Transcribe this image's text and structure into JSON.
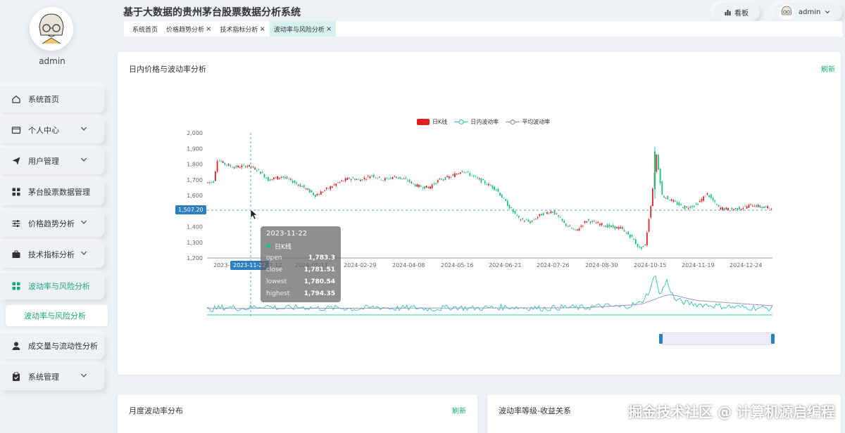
{
  "app": {
    "title": "基于大数据的贵州茅台股票数据分析系统"
  },
  "sidebar": {
    "username": "admin",
    "items": [
      {
        "label": "系统首页",
        "icon": "home-icon"
      },
      {
        "label": "个人中心",
        "icon": "id-card-icon"
      },
      {
        "label": "用户管理",
        "icon": "send-icon"
      },
      {
        "label": "茅台股票数据管理",
        "icon": "grid-icon"
      },
      {
        "label": "价格趋势分析",
        "icon": "sliders-icon"
      },
      {
        "label": "技术指标分析",
        "icon": "briefcase-icon"
      },
      {
        "label": "波动率与风险分析",
        "icon": "grid-icon"
      },
      {
        "label": "成交量与流动性分析",
        "icon": "user-icon"
      },
      {
        "label": "系统管理",
        "icon": "clipboard-icon"
      }
    ],
    "active_sub": "波动率与风险分析"
  },
  "tabs": [
    {
      "label": "系统首页",
      "closable": false
    },
    {
      "label": "价格趋势分析",
      "closable": true
    },
    {
      "label": "技术指标分析",
      "closable": true
    },
    {
      "label": "波动率与风险分析",
      "closable": true
    }
  ],
  "header": {
    "kanban": "看板",
    "user": "admin"
  },
  "main": {
    "card1_title": "日内价格与波动率分析",
    "refresh": "刷新",
    "card2_title": "月度波动率分布",
    "card3_title": "波动率等级-收益关系"
  },
  "tooltip": {
    "date": "2023-11-22",
    "series": "日K线",
    "rows": [
      {
        "k": "open",
        "v": "1,783.3"
      },
      {
        "k": "close",
        "v": "1,781.51"
      },
      {
        "k": "lowest",
        "v": "1,780.54"
      },
      {
        "k": "highest",
        "v": "1,794.35"
      }
    ]
  },
  "axis_pointer": {
    "y_label": "1,507.20",
    "x_label": "2023-11-22"
  },
  "colors": {
    "accent": "#19a974",
    "up": "#e02020",
    "down": "#19c37d",
    "vol_line": "#3fc8b8",
    "avg_line": "#a58fc8",
    "axis_tag": "#2c7fc0"
  },
  "watermark": "掘金技术社区 @ 计算机源启编程",
  "chart_data": {
    "type": "candlestick",
    "legend": [
      "日K线",
      "日内波动率",
      "平均波动率"
    ],
    "ylim": [
      1200,
      2000
    ],
    "y_ticks": [
      "2,000",
      "1,900",
      "1,800",
      "1,700",
      "1,600",
      "1,500",
      "1,400",
      "1,300",
      "1,200"
    ],
    "x_ticks": [
      "2023-",
      "2023-12-12",
      "2024-01-17",
      "2024-02-29",
      "2024-04-08",
      "2024-05-16",
      "2024-06-21",
      "2024-07-26",
      "2024-08-30",
      "2024-10-15",
      "2024-11-19",
      "2024-12-24"
    ],
    "price_path": [
      [
        0,
        1680
      ],
      [
        4,
        1690
      ],
      [
        6,
        1830
      ],
      [
        10,
        1800
      ],
      [
        15,
        1780
      ],
      [
        22,
        1790
      ],
      [
        28,
        1760
      ],
      [
        33,
        1700
      ],
      [
        40,
        1720
      ],
      [
        46,
        1690
      ],
      [
        52,
        1650
      ],
      [
        58,
        1600
      ],
      [
        64,
        1640
      ],
      [
        70,
        1680
      ],
      [
        76,
        1710
      ],
      [
        82,
        1700
      ],
      [
        88,
        1730
      ],
      [
        94,
        1700
      ],
      [
        100,
        1720
      ],
      [
        106,
        1700
      ],
      [
        112,
        1660
      ],
      [
        118,
        1650
      ],
      [
        124,
        1700
      ],
      [
        130,
        1720
      ],
      [
        136,
        1760
      ],
      [
        142,
        1720
      ],
      [
        148,
        1680
      ],
      [
        154,
        1640
      ],
      [
        160,
        1540
      ],
      [
        166,
        1450
      ],
      [
        172,
        1430
      ],
      [
        178,
        1480
      ],
      [
        184,
        1500
      ],
      [
        190,
        1420
      ],
      [
        196,
        1370
      ],
      [
        202,
        1440
      ],
      [
        208,
        1420
      ],
      [
        214,
        1400
      ],
      [
        220,
        1390
      ],
      [
        226,
        1330
      ],
      [
        230,
        1260
      ],
      [
        233,
        1280
      ],
      [
        236,
        1540
      ],
      [
        239,
        1860
      ],
      [
        242,
        1600
      ],
      [
        248,
        1560
      ],
      [
        254,
        1520
      ],
      [
        260,
        1540
      ],
      [
        266,
        1610
      ],
      [
        272,
        1520
      ],
      [
        278,
        1510
      ],
      [
        284,
        1520
      ],
      [
        290,
        1540
      ],
      [
        296,
        1520
      ],
      [
        300,
        1525
      ]
    ],
    "volatility_path": [
      [
        0,
        0.4
      ],
      [
        10,
        0.6
      ],
      [
        20,
        0.5
      ],
      [
        30,
        0.7
      ],
      [
        40,
        0.5
      ],
      [
        50,
        0.6
      ],
      [
        60,
        0.5
      ],
      [
        70,
        0.55
      ],
      [
        80,
        0.45
      ],
      [
        90,
        0.6
      ],
      [
        100,
        0.5
      ],
      [
        110,
        0.55
      ],
      [
        120,
        0.45
      ],
      [
        130,
        0.6
      ],
      [
        140,
        0.5
      ],
      [
        150,
        0.55
      ],
      [
        160,
        0.6
      ],
      [
        170,
        0.55
      ],
      [
        180,
        0.5
      ],
      [
        190,
        0.6
      ],
      [
        200,
        0.55
      ],
      [
        210,
        0.7
      ],
      [
        220,
        0.6
      ],
      [
        230,
        0.9
      ],
      [
        235,
        1.9
      ],
      [
        238,
        3.2
      ],
      [
        240,
        1.5
      ],
      [
        244,
        2.6
      ],
      [
        248,
        1.2
      ],
      [
        255,
        0.9
      ],
      [
        262,
        0.8
      ],
      [
        270,
        0.7
      ],
      [
        280,
        0.6
      ],
      [
        290,
        0.55
      ],
      [
        300,
        0.5
      ]
    ],
    "avg_volatility_path": [
      [
        0,
        0.5
      ],
      [
        100,
        0.52
      ],
      [
        200,
        0.55
      ],
      [
        230,
        0.8
      ],
      [
        245,
        1.6
      ],
      [
        260,
        1.1
      ],
      [
        300,
        0.7
      ]
    ]
  }
}
